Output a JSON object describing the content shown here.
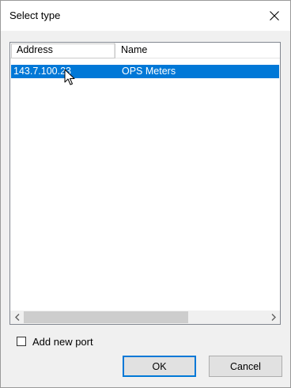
{
  "dialog": {
    "title": "Select type",
    "close_icon": "close-icon"
  },
  "list": {
    "columns": [
      "Address",
      "Name"
    ],
    "rows": [
      {
        "address": "143.7.100.23",
        "name": "OPS Meters",
        "selected": true
      }
    ],
    "scroll_left_icon": "chevron-left-icon",
    "scroll_right_icon": "chevron-right-icon"
  },
  "options": {
    "add_new_port_label": "Add new port",
    "add_new_port_checked": false
  },
  "buttons": {
    "ok_label": "OK",
    "cancel_label": "Cancel"
  },
  "colors": {
    "selection": "#0078d7",
    "background": "#f0f0f0"
  }
}
